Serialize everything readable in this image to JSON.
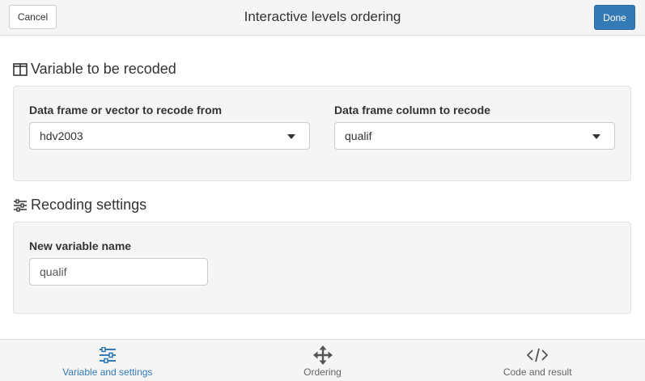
{
  "titlebar": {
    "cancel_label": "Cancel",
    "title": "Interactive levels ordering",
    "done_label": "Done"
  },
  "section1": {
    "heading": "Variable to be recoded",
    "icon": "columns-icon",
    "dataframe_label": "Data frame or vector to recode from",
    "dataframe_value": "hdv2003",
    "column_label": "Data frame column to recode",
    "column_value": "qualif"
  },
  "section2": {
    "heading": "Recoding settings",
    "icon": "sliders-icon",
    "newvar_label": "New variable name",
    "newvar_value": "qualif"
  },
  "tabs": [
    {
      "label": "Variable and settings",
      "icon": "sliders-icon",
      "active": true
    },
    {
      "label": "Ordering",
      "icon": "arrows-move-icon",
      "active": false
    },
    {
      "label": "Code and result",
      "icon": "code-icon",
      "active": false
    }
  ],
  "colors": {
    "accent": "#337ab7",
    "panel_bg": "#f5f5f5"
  }
}
